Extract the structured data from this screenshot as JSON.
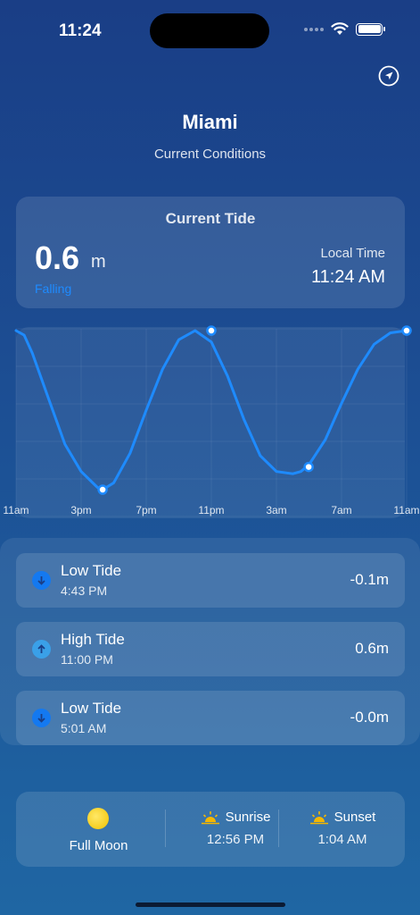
{
  "status_bar": {
    "time": "11:24"
  },
  "header": {
    "city": "Miami",
    "subtitle": "Current Conditions"
  },
  "current_tide": {
    "title": "Current Tide",
    "height": "0.6",
    "unit": "m",
    "trend": "Falling",
    "local_time_label": "Local Time",
    "local_time": "11:24 AM"
  },
  "chart_data": {
    "type": "line",
    "x_tick_labels": [
      "11am",
      "3pm",
      "7pm",
      "11pm",
      "3am",
      "7am",
      "11am"
    ],
    "x_hours": [
      0,
      24
    ],
    "y_unit": "m",
    "ylim": [
      -0.1,
      0.6
    ],
    "grid": true,
    "series": [
      {
        "x": [
          0,
          0.5,
          1,
          2,
          3,
          4,
          5,
          5.32,
          6,
          7,
          8,
          9,
          10,
          11,
          12,
          13,
          14,
          15,
          16,
          17,
          17.5,
          18,
          19,
          20,
          21,
          22,
          23,
          24
        ],
        "values": [
          0.6,
          0.58,
          0.5,
          0.3,
          0.1,
          -0.02,
          -0.09,
          -0.1,
          -0.07,
          0.06,
          0.25,
          0.43,
          0.56,
          0.6,
          0.55,
          0.4,
          0.21,
          0.05,
          -0.02,
          -0.03,
          -0.02,
          0.01,
          0.12,
          0.28,
          0.43,
          0.54,
          0.59,
          0.6
        ]
      }
    ],
    "markers": [
      {
        "x": 5.32,
        "value": -0.1
      },
      {
        "x": 12.0,
        "value": 0.6
      },
      {
        "x": 17.98,
        "value": -0.0
      },
      {
        "x": 24.0,
        "value": 0.6
      }
    ],
    "line_color": "#1e8bff"
  },
  "events": [
    {
      "name": "Low Tide",
      "time": "4:43 PM",
      "height": "-0.1m",
      "type": "low",
      "icon": "arrow-down-icon"
    },
    {
      "name": "High Tide",
      "time": "11:00 PM",
      "height": "0.6m",
      "type": "high",
      "icon": "arrow-up-icon"
    },
    {
      "name": "Low Tide",
      "time": "5:01 AM",
      "height": "-0.0m",
      "type": "low",
      "icon": "arrow-down-icon"
    }
  ],
  "astronomy": {
    "moon_phase": "Full Moon",
    "sunrise_label": "Sunrise",
    "sunrise_time": "12:56 PM",
    "sunset_label": "Sunset",
    "sunset_time": "1:04 AM"
  },
  "colors": {
    "accent": "#1e8bff",
    "moon": "#f2c200",
    "sun": "#f5b700"
  }
}
